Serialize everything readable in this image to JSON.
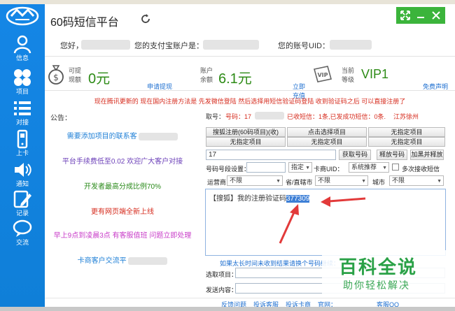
{
  "window": {
    "title": "60码短信平台"
  },
  "sidebar": {
    "items": [
      {
        "label": "信息",
        "icon": "user-icon"
      },
      {
        "label": "项目",
        "icon": "grid-icon"
      },
      {
        "label": "对接",
        "icon": "list-icon"
      },
      {
        "label": "上卡",
        "icon": "phone-icon"
      },
      {
        "label": "通知",
        "icon": "speaker-icon"
      },
      {
        "label": "记录",
        "icon": "edit-icon"
      },
      {
        "label": "交流",
        "icon": "chat-icon"
      }
    ]
  },
  "userline": {
    "hello": "您好，",
    "alipay_label": "您的支付宝账户是：",
    "uid_label": "您的账号UID："
  },
  "cards": {
    "withdraw": {
      "label1": "可提",
      "label2": "现额",
      "value": "0元",
      "link": "申请提现"
    },
    "balance": {
      "label1": "账户",
      "label2": "余额",
      "value": "6.1元",
      "link": "立即充值"
    },
    "level": {
      "label1": "当前",
      "label2": "等级",
      "value": "VIP1",
      "link": "免费声明",
      "badge": "VIP"
    }
  },
  "notice": "现在腾讯更新的 现在国内注册方法是 先发微信登陆 然后选择用短信验证码登陆 收到验证码之后 可以直接注册了",
  "left": {
    "header": "公告：",
    "lines": [
      {
        "text": "需要添加项目的联系客",
        "color": "#1e7fd6"
      },
      {
        "text": "平台手续费低至0.02 欢迎广大客户对接",
        "color": "#6b3fb8"
      },
      {
        "text": "开发者最高分成比例70%",
        "color": "#2a8a1a"
      },
      {
        "text": "更有网页端全新上线",
        "color": "#d62b1d"
      },
      {
        "text": "早上9点到凌晨3点 有客服值班 问题立即处理",
        "color": "#c83cc8"
      },
      {
        "text": "卡商客户交流平",
        "color": "#1e7fd6"
      }
    ]
  },
  "right": {
    "status": {
      "label": "取号：",
      "number_label": "号码：17",
      "received": "已收短信：1条,已发成功短信：0条.",
      "location": "江苏徐州"
    },
    "project_buttons": [
      "搜狐注册(60码项目)(收)",
      "点击选择项目",
      "无指定项目",
      "无指定项目",
      "无指定项目",
      "无指定项目"
    ],
    "phone_value": "17",
    "buttons": {
      "get": "获取号码",
      "release": "释放号码",
      "add_release": "加黑并释放"
    },
    "segment_label": "号码号段设置：",
    "designate": "指定",
    "card_uid_label": "卡商UID：",
    "recommend": "系统推荐",
    "multi_receive": "多次接收短信",
    "operator_label": "运营商",
    "operator_value": "不限",
    "province_label": "省/直辖市",
    "province_value": "不限",
    "city_label": "城市",
    "city_value": "不限",
    "sms_prefix": "【搜狐】我的注册验证码",
    "sms_code": "377309",
    "hint": "如果太长时间未收到结果请换个号码继续：",
    "select_project_label": "选取项目：",
    "send_content_label": "发送内容："
  },
  "footer": {
    "feedback": "反馈问题",
    "complain_service": "投诉客服",
    "complain_card": "投诉卡商",
    "website": "官网：",
    "qq": "客服QQ"
  },
  "watermark": {
    "title": "百科全说",
    "subtitle": "助你轻松解决"
  },
  "colors": {
    "sidebar": "#1586e6",
    "green_value": "#2d8b16",
    "link": "#1e6fd0",
    "notice_red": "#d62b1d",
    "highlight": "#3d7fd6"
  }
}
